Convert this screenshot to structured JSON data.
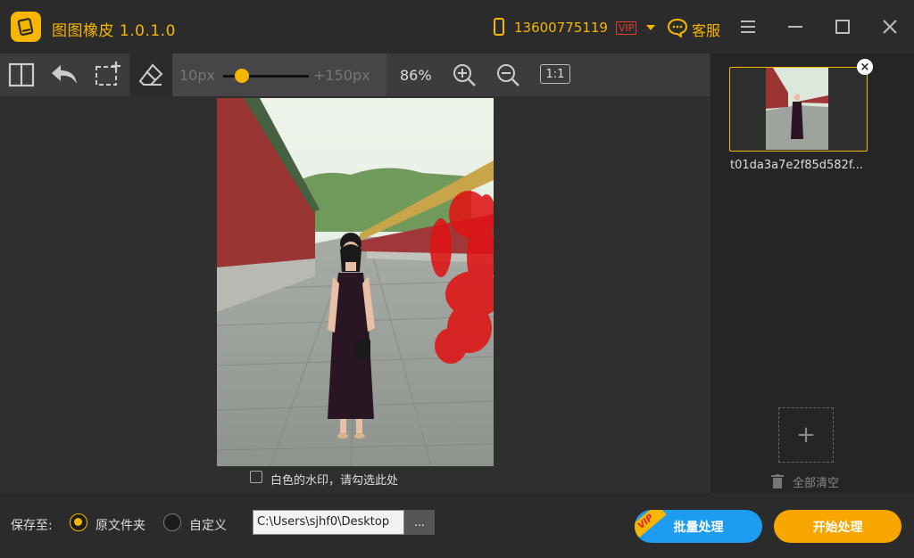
{
  "app": {
    "name": "图图橡皮",
    "version": "1.0.1.0",
    "title": "图图橡皮  1.0.1.0"
  },
  "account": {
    "phone": "13600775119",
    "vip": "VIP",
    "service": "客服"
  },
  "toolbar": {
    "brush_min": "10px",
    "brush_max": "+150px",
    "brush_level": 0.22,
    "zoom": "86%",
    "ratio": "1:1",
    "icons": [
      "split-view-icon",
      "undo-icon",
      "crop-icon",
      "eraser-icon",
      "zoom-in-icon",
      "zoom-out-icon"
    ]
  },
  "canvas": {
    "watermark_label": "白色的水印，请勾选此处",
    "watermark_checked": false
  },
  "files": {
    "items": [
      {
        "name": "t01da3a7e2f85d582f..."
      }
    ],
    "clear_all": "全部清空"
  },
  "bottom": {
    "save_to": "保存至:",
    "opt_original": "原文件夹",
    "opt_custom": "自定义",
    "selected": "原文件夹",
    "path": "C:\\Users\\sjhf0\\Desktop",
    "browse": "...",
    "batch": "批量处理",
    "batch_badge": "VIP",
    "start": "开始处理"
  },
  "colors": {
    "accent": "#f7b600",
    "batch": "#1e9cf0",
    "start": "#f7a600",
    "mask": "#e01414"
  }
}
